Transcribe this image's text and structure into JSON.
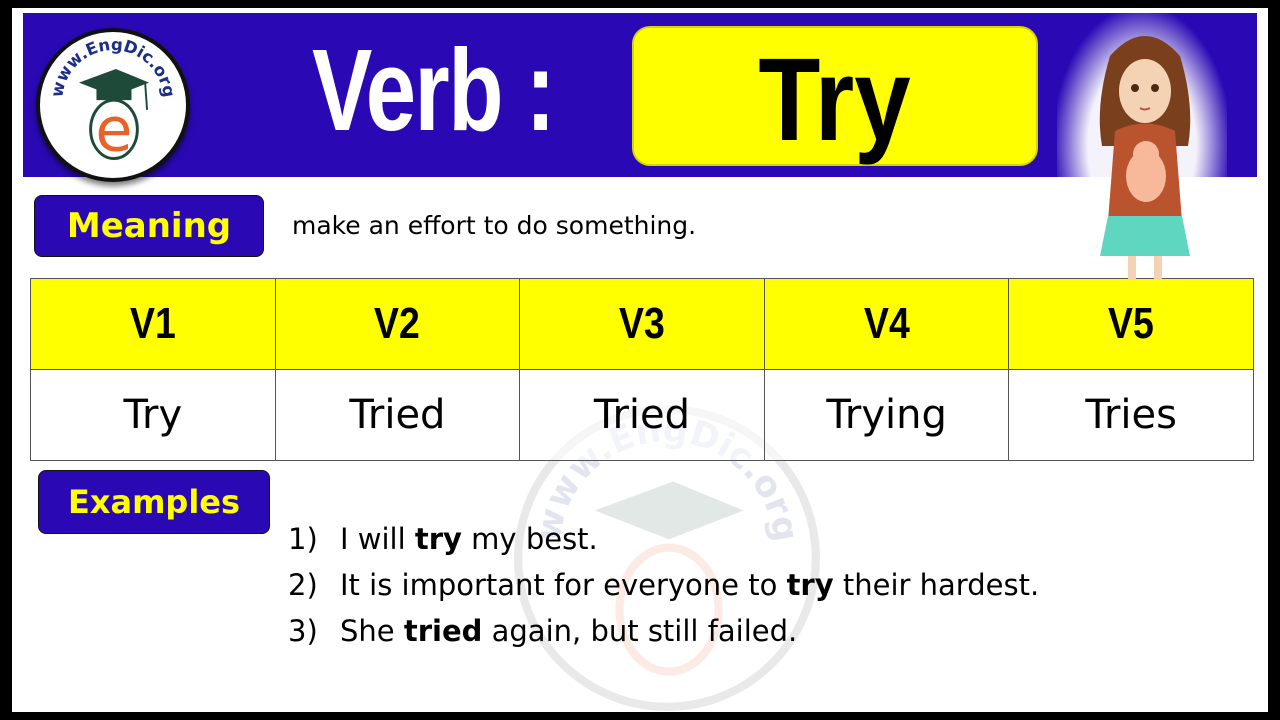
{
  "logo": {
    "text": "www.EngDic.org",
    "letter": "e"
  },
  "title": {
    "prefix": "Verb :",
    "word": "Try"
  },
  "meaning": {
    "label": "Meaning",
    "text": "make an effort to do something."
  },
  "forms_table": {
    "headers": [
      "V1",
      "V2",
      "V3",
      "V4",
      "V5"
    ],
    "values": [
      "Try",
      "Tried",
      "Tried",
      "Trying",
      "Tries"
    ]
  },
  "examples": {
    "label": "Examples",
    "items": [
      {
        "num": "1)",
        "before": "I will ",
        "bold": "try",
        "after": " my best."
      },
      {
        "num": "2)",
        "before": "It is important for everyone to ",
        "bold": "try",
        "after": " their hardest."
      },
      {
        "num": "3)",
        "before": "She ",
        "bold": "tried",
        "after": " again, but still failed."
      }
    ]
  },
  "colors": {
    "banner": "#2a09b5",
    "highlight": "#ffff00",
    "logo_e": "#e8632a",
    "logo_cap": "#1e4a3a"
  }
}
